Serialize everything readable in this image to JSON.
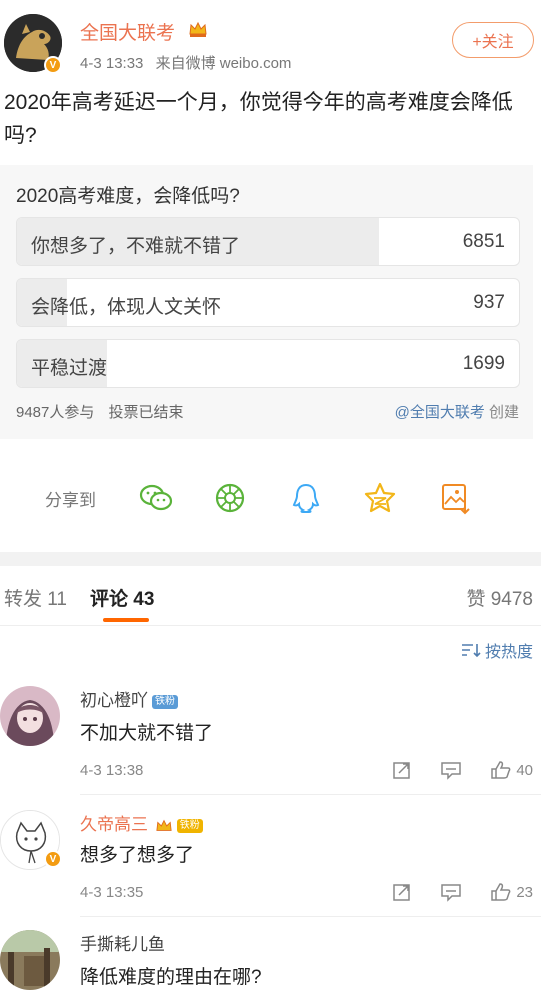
{
  "post": {
    "author": "全国大联考",
    "time": "4-3 13:33",
    "source": "来自微博 weibo.com",
    "follow_label": "+关注",
    "text": "2020年高考延迟一个月，你觉得今年的高考难度会降低吗?"
  },
  "poll": {
    "title": "2020高考难度，会降低吗?",
    "options": [
      {
        "label": "你想多了，不难就不错了",
        "count": "6851",
        "share": 0.722
      },
      {
        "label": "会降低，体现人文关怀",
        "count": "937",
        "share": 0.099
      },
      {
        "label": "平稳过渡",
        "count": "1699",
        "share": 0.179
      }
    ],
    "participants": "9487人参与",
    "status": "投票已结束",
    "creator_link": "@全国大联考",
    "creator_suffix": " 创建"
  },
  "share": {
    "label": "分享到",
    "icons": [
      "wechat-icon",
      "moments-icon",
      "qq-icon",
      "qzone-icon",
      "save-image-icon"
    ],
    "colors": {
      "green": "#5ab33a",
      "blue": "#3da9f5",
      "yellow": "#f2b619",
      "orange": "#f08a24"
    }
  },
  "tabs": {
    "repost": "转发 11",
    "comment": "评论 43",
    "likes": "赞 9478"
  },
  "sort": {
    "label": "按热度"
  },
  "comments": [
    {
      "name": "初心橙吖",
      "badge": "铁粉",
      "text": "不加大就不错了",
      "time": "4-3 13:38",
      "likes": "40"
    },
    {
      "name": "久帝高三",
      "badge": "铁粉",
      "text": "想多了想多了",
      "time": "4-3 13:35",
      "likes": "23"
    },
    {
      "name": "手撕耗儿鱼",
      "text": "降低难度的理由在哪?"
    }
  ],
  "colors": {
    "accent": "#eb7350",
    "link": "#507daf",
    "tab_underline": "#ff6600"
  }
}
